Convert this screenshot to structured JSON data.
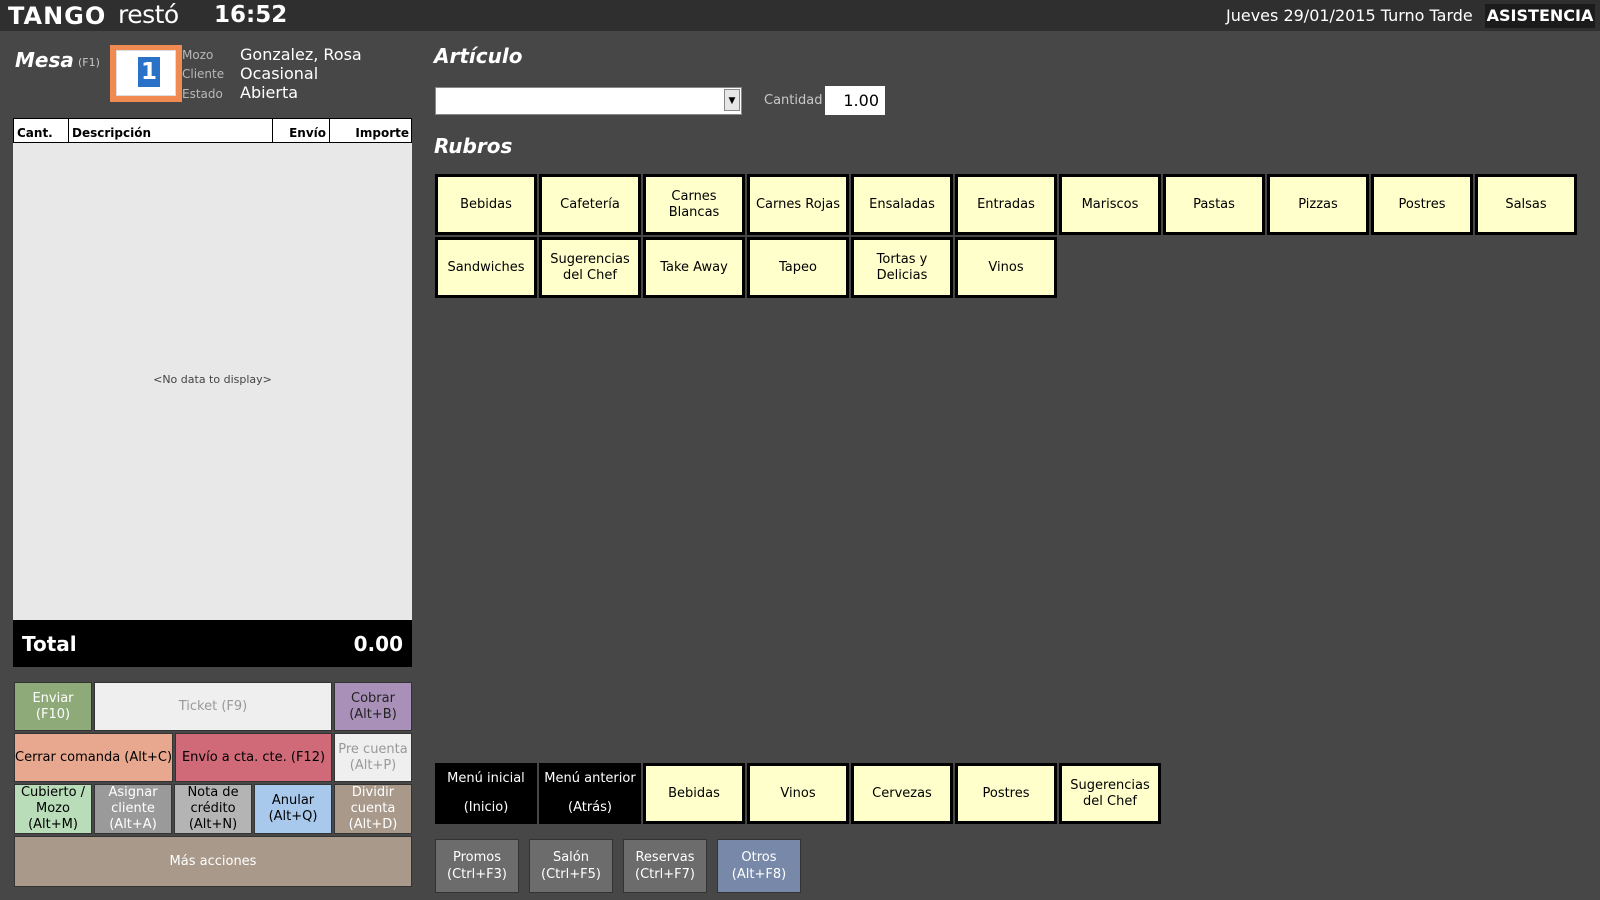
{
  "header": {
    "logo_main": "TANGO",
    "logo_sub": "restó",
    "clock": "16:52",
    "datetime": "Jueves 29/01/2015 Turno Tarde",
    "asistencia": "ASISTENCIA"
  },
  "mesa": {
    "title": "Mesa",
    "shortcut": "(F1)",
    "number": "1",
    "mozo_label": "Mozo",
    "mozo": "Gonzalez, Rosa",
    "cliente_label": "Cliente",
    "cliente": "Ocasional",
    "estado_label": "Estado",
    "estado": "Abierta"
  },
  "grid": {
    "columns": [
      "Cant.",
      "Descripción",
      "Envío",
      "Importe"
    ],
    "empty_text": "<No data to display>",
    "total_label": "Total",
    "total_value": "0.00"
  },
  "actions": {
    "enviar": "Enviar (F10)",
    "ticket": "Ticket (F9)",
    "cobrar": "Cobrar\n(Alt+B)",
    "cerrar": "Cerrar comanda (Alt+C)",
    "envio_cta": "Envío a cta. cte. (F12)",
    "pre_cuenta": "Pre cuenta\n(Alt+P)",
    "cubierto": "Cubierto /\nMozo\n(Alt+M)",
    "asignar": "Asignar\ncliente\n(Alt+A)",
    "nota": "Nota de\ncrédito\n(Alt+N)",
    "anular": "Anular\n(Alt+Q)",
    "dividir": "Dividir\ncuenta\n(Alt+D)",
    "mas": "Más acciones"
  },
  "articulo": {
    "title": "Artículo",
    "select_value": "",
    "cantidad_label": "Cantidad",
    "cantidad_value": "1.00"
  },
  "rubros": {
    "title": "Rubros",
    "items": [
      "Bebidas",
      "Cafetería",
      "Carnes Blancas",
      "Carnes Rojas",
      "Ensaladas",
      "Entradas",
      "Mariscos",
      "Pastas",
      "Pizzas",
      "Postres",
      "Salsas",
      "Sandwiches",
      "Sugerencias del Chef",
      "Take Away",
      "Tapeo",
      "Tortas y Delicias",
      "Vinos"
    ]
  },
  "menu_bar": {
    "menu_inicial": "Menú inicial",
    "menu_inicial_key": "(Inicio)",
    "menu_anterior": "Menú anterior",
    "menu_anterior_key": "(Atrás)",
    "items": [
      "Bebidas",
      "Vinos",
      "Cervezas",
      "Postres",
      "Sugerencias del Chef"
    ]
  },
  "bottom": {
    "promos": "Promos\n(Ctrl+F3)",
    "salon": "Salón\n(Ctrl+F5)",
    "reservas": "Reservas\n(Ctrl+F7)",
    "otros": "Otros\n(Alt+F8)"
  }
}
